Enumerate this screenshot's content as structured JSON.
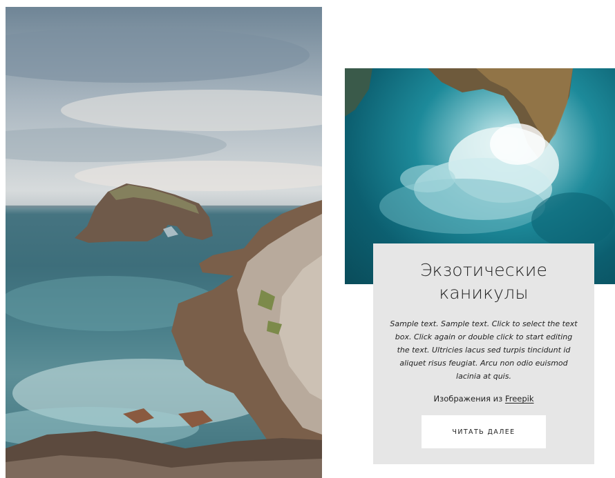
{
  "card": {
    "title_line1": "Экзотические",
    "title_line2": "каникулы",
    "body": "Sample text. Sample text. Click to select the text box. Click again or double click to start editing the text. Ultricies lacus sed turpis tincidunt id aliquet risus feugiat. Arcu non odio euismod lacinia at quis.",
    "credits_prefix": "Изображения из ",
    "credits_link": "Freepik",
    "button_label": "ЧИТАТЬ ДАЛЕЕ"
  },
  "images": {
    "left": "coastal-rock-arch-photo",
    "right": "aerial-ocean-waves-photo"
  },
  "colors": {
    "card_background": "#e6e6e6",
    "button_background": "#ffffff",
    "text": "#222222"
  }
}
